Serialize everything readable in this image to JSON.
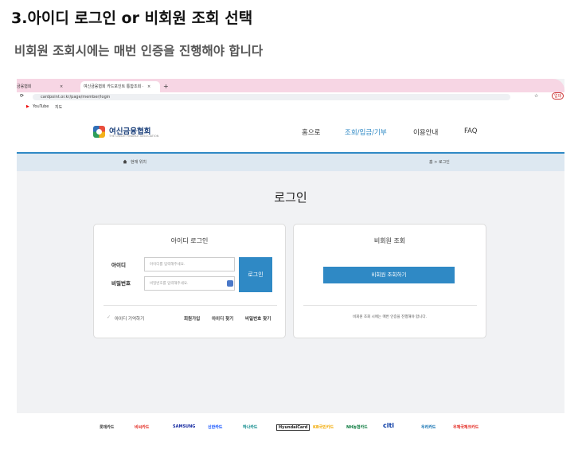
{
  "heading": "3.아이디 로그인 or 비회원 조회 선택",
  "subheading": "비회원 조회시에는 매번 인증을 진행해야 합니다",
  "browser": {
    "tab1_title": "금융협회",
    "tab2_title": "여신금융협회 카드포인트 통합조회 ·",
    "new_tab": "+",
    "close": "×",
    "url": "cardpoint.or.kr/page/member/login",
    "bookmark1": "YouTube",
    "bookmark2": "지도",
    "profile": "업데"
  },
  "site": {
    "logo_text": "여신금융협회",
    "logo_sub": "THE CREDIT FINANCE ASSOCIATION",
    "nav": [
      "홈으로",
      "조회/입금/기부",
      "이용안내",
      "FAQ"
    ],
    "location_label": "현재 위치",
    "breadcrumb": "홈 > 로그인",
    "page_title": "로그인"
  },
  "id_login": {
    "title": "아이디 로그인",
    "id_label": "아이디",
    "id_placeholder": "아이디를 입력해주세요.",
    "pw_label": "비밀번호",
    "pw_placeholder": "비밀번호를 입력해주세요.",
    "login_button": "로그인",
    "remember": "아이디 기억하기",
    "links": [
      "회원가입",
      "아이디 찾기",
      "비밀번호 찾기"
    ]
  },
  "guest": {
    "title": "비회원 조회",
    "button": "비회원 조회하기",
    "note": "비회원 조회 시에는 매번 인증을 진행해야 합니다."
  },
  "footer_logos": [
    {
      "name": "롯데카드",
      "color": "#333333"
    },
    {
      "name": "비씨카드",
      "color": "#e2231a"
    },
    {
      "name": "SAMSUNG",
      "color": "#1428a0"
    },
    {
      "name": "신한카드",
      "color": "#0046ff"
    },
    {
      "name": "하나카드",
      "color": "#008485"
    },
    {
      "name": "HyundaiCard",
      "color": "#222222"
    },
    {
      "name": "KB국민카드",
      "color": "#f2a900"
    },
    {
      "name": "NH농협카드",
      "color": "#0b7a3e"
    },
    {
      "name": "citi",
      "color": "#0033a0"
    },
    {
      "name": "우리카드",
      "color": "#0067ac"
    },
    {
      "name": "우체국체크카드",
      "color": "#e2231a"
    }
  ],
  "colors": {
    "accent": "#2f89c5",
    "tabbar": "#f7d6e4",
    "locbar": "#dde8f1"
  }
}
